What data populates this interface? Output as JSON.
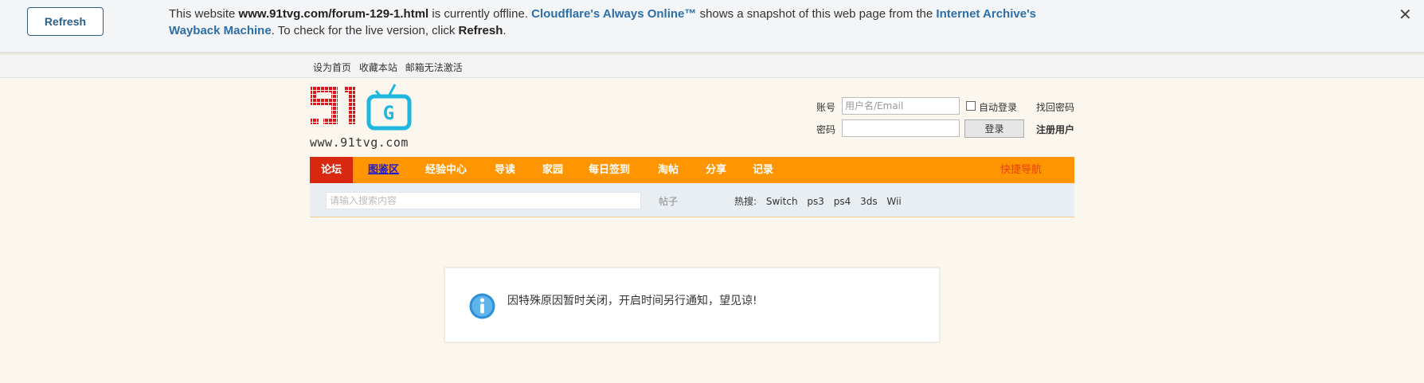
{
  "cloudflare": {
    "refresh_button": "Refresh",
    "msg_1": "This website ",
    "msg_url": "www.91tvg.com/forum-129-1.html",
    "msg_2": " is currently offline. ",
    "msg_cf": "Cloudflare's Always Online™",
    "msg_3": " shows a snapshot of this web page from the ",
    "msg_archive": "Internet Archive's Wayback Machine",
    "msg_4": ". To check for the live version, click ",
    "msg_refresh": "Refresh",
    "msg_5": ".",
    "close_glyph": "✕"
  },
  "topbar": {
    "links": [
      "设为首页",
      "收藏本站",
      "邮箱无法激活"
    ]
  },
  "header": {
    "logo_text": "91",
    "logo_tv_letter": "G",
    "logo_url": "www.91tvg.com"
  },
  "login": {
    "account_label": "账号",
    "account_placeholder": "用户名/Email",
    "password_label": "密码",
    "auto_login": "自动登录",
    "forgot_password": "找回密码",
    "login_button": "登录",
    "register": "注册用户"
  },
  "nav": {
    "items": [
      "论坛",
      "图鉴区",
      "经验中心",
      "导读",
      "家园",
      "每日签到",
      "淘帖",
      "分享",
      "记录"
    ],
    "quick_nav": "快捷导航"
  },
  "search": {
    "placeholder": "请输入搜索内容",
    "type": "帖子",
    "hot_label": "热搜:",
    "hot_terms": [
      "Switch",
      "ps3",
      "ps4",
      "3ds",
      "Wii"
    ]
  },
  "notice": {
    "message": "因特殊原因暂时关闭，开启时间另行通知，望见谅!"
  },
  "colors": {
    "nav_bg": "#ff9500",
    "nav_active": "#d8280f",
    "link_blue": "#2c6ea8",
    "logo_red": "#d8161b",
    "logo_cyan": "#1fb6e0"
  },
  "icons": {
    "close": "close-icon",
    "checkbox": "checkbox-icon",
    "info": "info-icon"
  }
}
